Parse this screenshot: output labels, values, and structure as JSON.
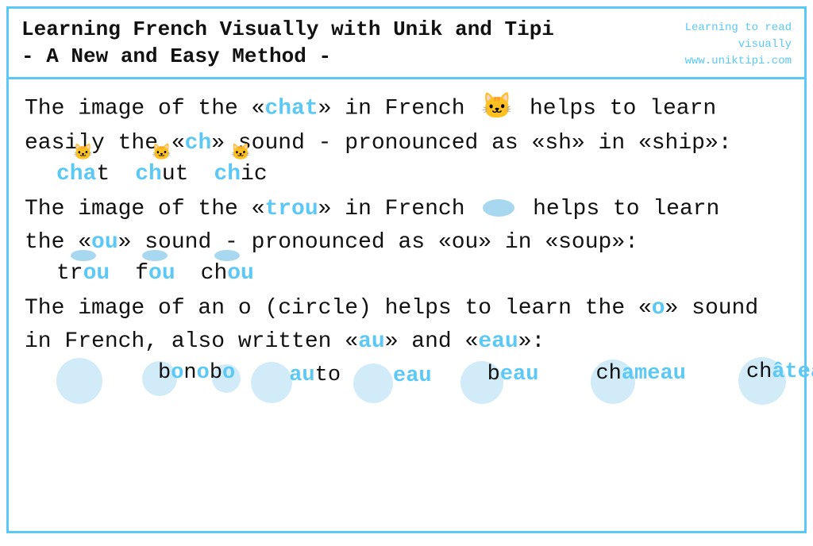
{
  "header": {
    "title_line1": "Learning French Visually with Unik and Tipi",
    "title_line2": "- A New and Easy Method -",
    "subtitle_line1": "Learning to read",
    "subtitle_line2": "visually",
    "subtitle_line3": "www.uniktipi.com"
  },
  "section1": {
    "line1": "The image of the «chat» in French",
    "line2": "easily the «ch» sound - pronounced as «sh» in «ship»:",
    "suffix1": "helps to learn",
    "words": [
      "chat",
      "chut",
      "chic"
    ]
  },
  "section2": {
    "line1": "The image of the «trou» in French",
    "suffix1": "helps to learn",
    "line2": "the «ou» sound - pronounced as «ou» in «soup»:",
    "words": [
      "trou",
      "fou",
      "chou"
    ]
  },
  "section3": {
    "line1": "The image of an o (circle) helps to learn the «o» sound",
    "line2": "in French, also written «au» and «eau»:",
    "words": [
      "bonobo",
      "auto",
      "eau",
      "beau",
      "chameau",
      "château"
    ]
  }
}
